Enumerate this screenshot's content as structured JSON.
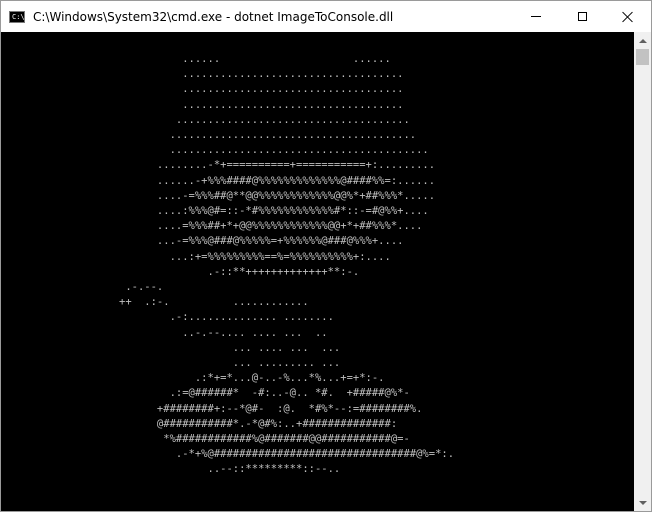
{
  "window": {
    "title": "C:\\Windows\\System32\\cmd.exe - dotnet  ImageToConsole.dll",
    "icon_name": "cmd-icon",
    "icon_text": "C:\\"
  },
  "console": {
    "text_color": "#c0c0c0",
    "background": "#000000",
    "ascii_art": "          ......                     ......\n          ...................................\n          ...................................\n          ...................................\n         .....................................\n        .......................................\n        .........................................\n      ........-*+==========+===========+:.........\n      ......-+%%%####@%%%%%%%%%%%%%@####%%=:......\n      ....-=%%%##@**@@%%%%%%%%%%%%@@%*+##%%%*.....\n      ....:%%%@#=::-*#%%%%%%%%%%%%#*::-=#@%%+....\n      ....=%%%##+*+@@%%%%%%%%%%%%@@+*+##%%%*....\n      ...-=%%%@###@%%%%%=+%%%%%%@###@%%%+....\n        ...:+=%%%%%%%%%==%=%%%%%%%%%%+:....\n              .-::**+++++++++++++**:-.\n .-.--.\n++  .:-.          ............\n        .-:.............. ........\n          ..-.--.... .... ...  ..\n                  ... .... ...  ...\n                  ... ......... ...\n            .:*+=*...@-..-%...*%...+=+*:-.\n        .:=@######*  -#:..-@.. *#.  +#####@%*-\n      +########+:--*@#-  :@.  *#%*--:=########%.\n      @###########*.-*@#%:..+##############:\n       *%############%@#######@@###########@=-\n         .-*+%@################################@%=*:.\n              ..--::*********::--.."
  }
}
